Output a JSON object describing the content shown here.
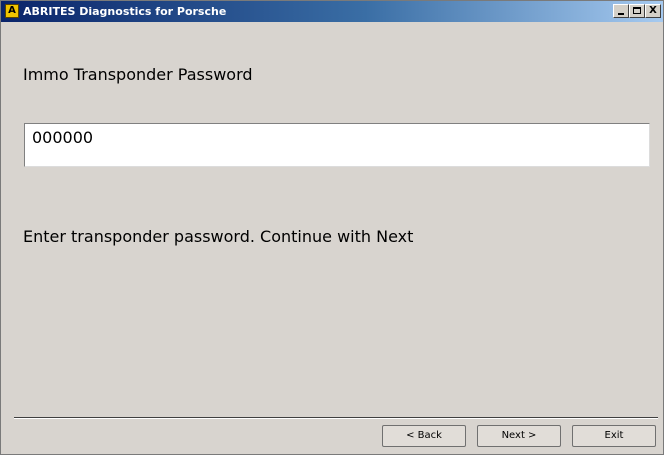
{
  "window": {
    "title": "ABRITES Diagnostics for Porsche",
    "icon_letter": "A",
    "controls": {
      "minimize": "_",
      "maximize": "□",
      "close": "X"
    }
  },
  "form": {
    "heading": "Immo Transponder Password",
    "password_value": "000000",
    "instruction": "Enter transponder password. Continue with Next"
  },
  "buttons": {
    "back": "< Back",
    "next": "Next >",
    "exit": "Exit"
  }
}
